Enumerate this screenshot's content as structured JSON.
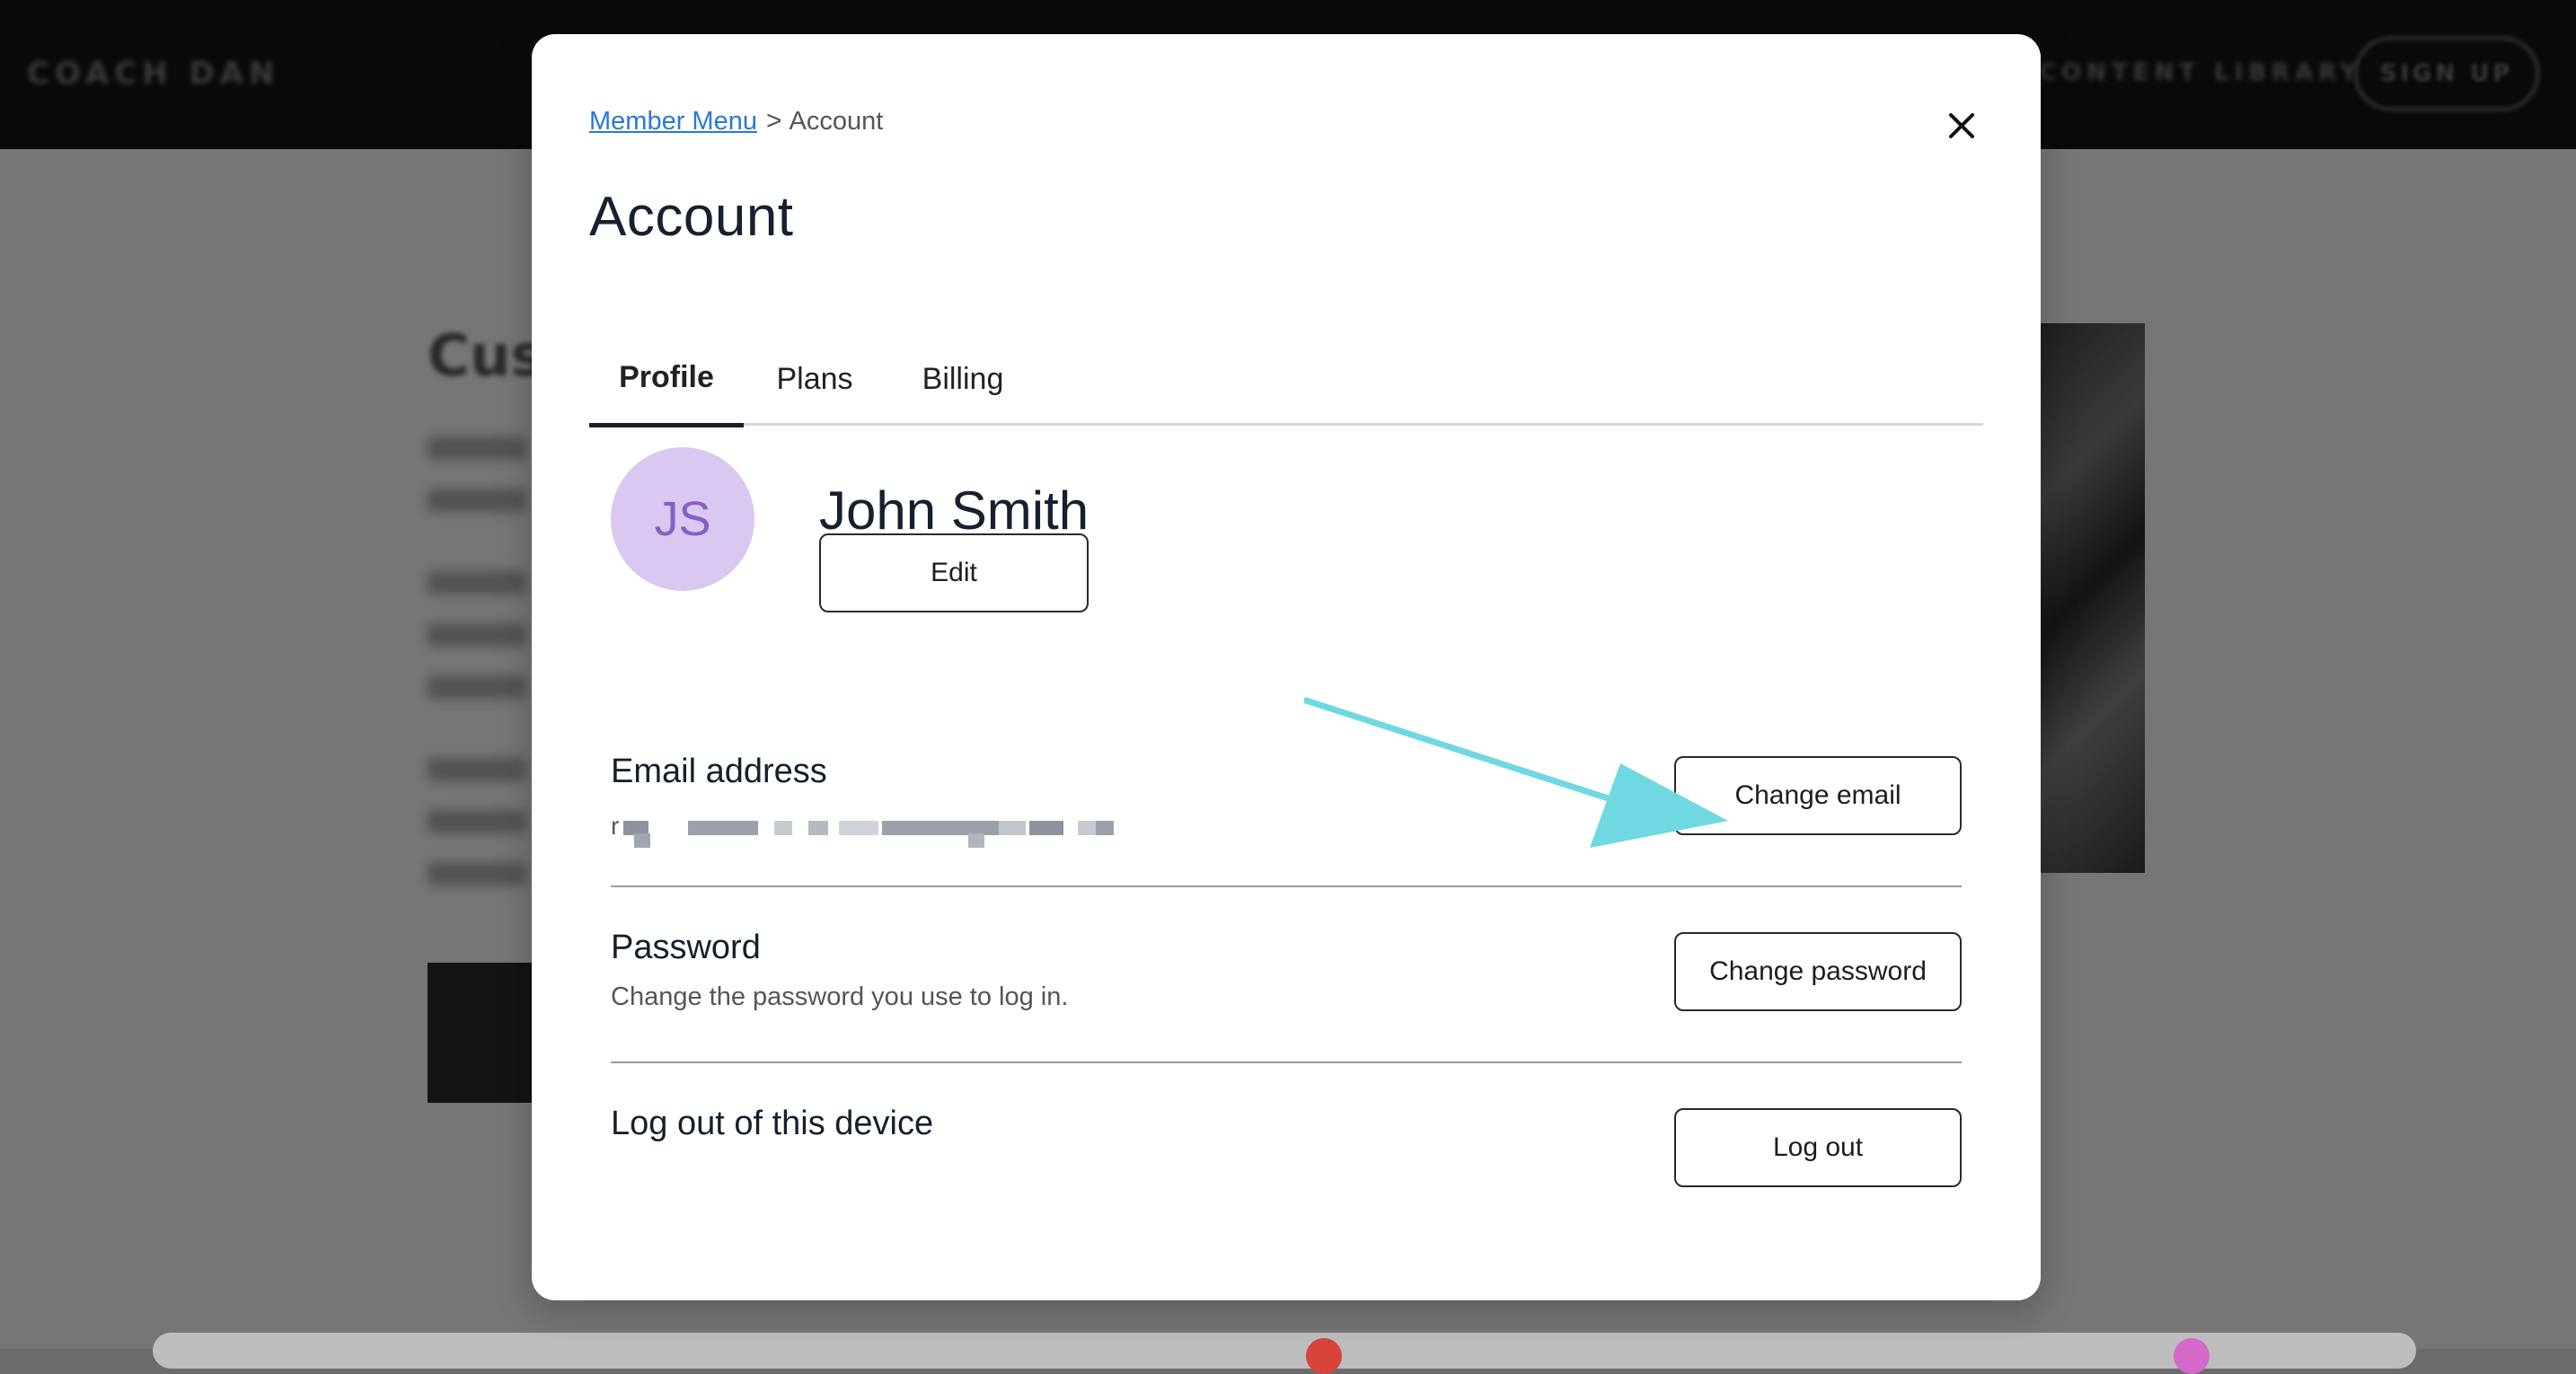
{
  "background": {
    "logo": "COACH DAN",
    "nav_link": "CONTENT LIBRARY",
    "signup_label": "SIGN UP",
    "title_fragment": "Cus"
  },
  "modal": {
    "breadcrumb": {
      "parent": "Member Menu",
      "separator": ">",
      "current": "Account"
    },
    "title": "Account",
    "tabs": [
      {
        "label": "Profile",
        "active": true
      },
      {
        "label": "Plans",
        "active": false
      },
      {
        "label": "Billing",
        "active": false
      }
    ],
    "profile": {
      "initials": "JS",
      "name": "John Smith",
      "edit_label": "Edit"
    },
    "email": {
      "title": "Email address",
      "value_first_char": "r",
      "button_label": "Change email"
    },
    "password": {
      "title": "Password",
      "description": "Change the password you use to log in.",
      "button_label": "Change password"
    },
    "logout": {
      "title": "Log out of this device",
      "button_label": "Log out"
    }
  },
  "colors": {
    "link": "#2a78d8",
    "avatar_bg": "#d9c8ef",
    "avatar_text": "#8660c4",
    "arrow": "#6fd8e0",
    "text_dark": "#16202e"
  },
  "icons": {
    "close": "close-icon",
    "breadcrumb_chevron": "chevron-right-icon",
    "annotation_arrow": "arrow-icon"
  }
}
